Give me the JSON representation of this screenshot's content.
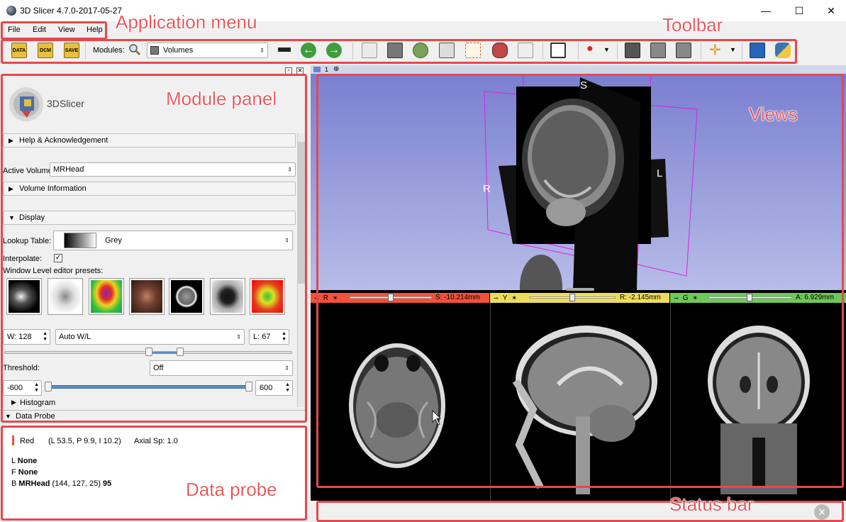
{
  "window": {
    "title": "3D Slicer 4.7.0-2017-05-27",
    "minimize": "—",
    "maximize": "☐",
    "close": "✕"
  },
  "menu": [
    "File",
    "Edit",
    "View",
    "Help"
  ],
  "toolbar": {
    "data_label": "DATA",
    "dcm_label": "DCM",
    "save_label": "SAVE",
    "modules_label": "Modules:",
    "module_selected": "Volumes"
  },
  "module_panel": {
    "logo_text": "3DSlicer",
    "help_section": "Help & Acknowledgement",
    "active_volume_label": "Active Volume",
    "active_volume_value": "MRHead",
    "volume_info_section": "Volume Information",
    "display_section": "Display",
    "lookup_table_label": "Lookup Table:",
    "lookup_table_value": "Grey",
    "interpolate_label": "Interpolate:",
    "interpolate_check": "✓",
    "wl_presets_label": "Window Level editor presets:",
    "window_value": "W: 128",
    "auto_wl": "Auto W/L",
    "level_value": "L: 67",
    "threshold_label": "Threshold:",
    "threshold_value": "Off",
    "threshold_min": "-600",
    "threshold_max": "600",
    "histogram_section": "Histogram",
    "data_probe_section": "Data Probe"
  },
  "data_probe": {
    "view": "Red",
    "coords": "(L 53.5, P 9.9, I 10.2)",
    "spacing": "Axial Sp: 1.0",
    "l_prefix": "L",
    "l_value": "None",
    "f_prefix": "F",
    "f_value": "None",
    "b_prefix": "B",
    "b_name": "MRHead",
    "b_ijk": "(144, 127,  25)",
    "b_value": "95"
  },
  "views": {
    "layout_num": "1",
    "label_R": "R",
    "label_L": "L",
    "label_S": "S",
    "red": {
      "letter": "R",
      "offset": "S: -10.214mm",
      "color": "#f2513b"
    },
    "yellow": {
      "letter": "Y",
      "offset": "R: -2.145mm",
      "color": "#eddc5c"
    },
    "green": {
      "letter": "G",
      "offset": "A: 6.929mm",
      "color": "#6ec85b"
    }
  },
  "annotations": {
    "application_menu": "Application menu",
    "toolbar": "Toolbar",
    "module_panel": "Module panel",
    "views": "Views",
    "data_probe": "Data probe",
    "status_bar": "Status bar"
  }
}
